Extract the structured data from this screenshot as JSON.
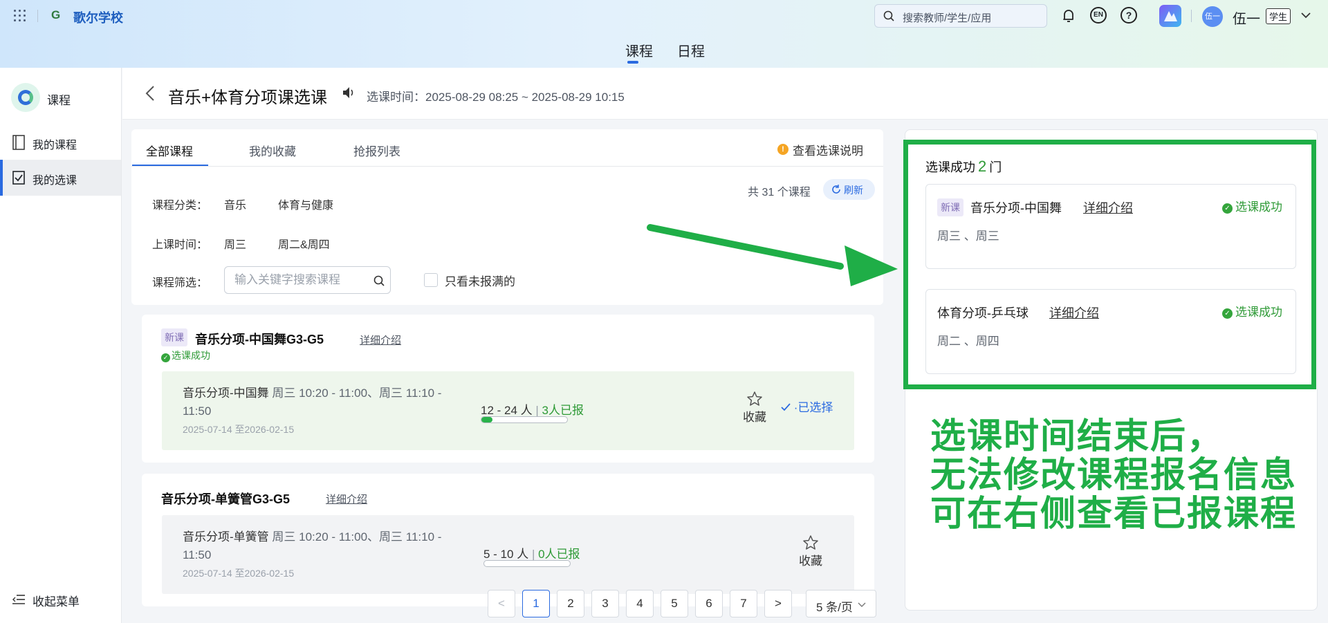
{
  "header": {
    "school_logo_letter": "G",
    "school_name": "歌尔学校",
    "search_placeholder": "搜索教师/学生/应用",
    "lang_badge": "EN",
    "help_mark": "?",
    "avatar_text": "伍一",
    "user_name": "伍一",
    "role_tag": "学生",
    "nav_tabs": [
      {
        "label": "课程"
      },
      {
        "label": "日程"
      }
    ],
    "active_nav": "课程"
  },
  "sidebar": {
    "title": "课程",
    "items": [
      {
        "label": "我的课程"
      },
      {
        "label": "我的选课"
      }
    ],
    "collapse_label": "收起菜单"
  },
  "page": {
    "title": "音乐+体育分项课选课",
    "time_label": "选课时间：2025-08-29 08:25 ~ 2025-08-29 10:15"
  },
  "tabs": [
    {
      "label": "全部课程"
    },
    {
      "label": "我的收藏"
    },
    {
      "label": "抢报列表"
    }
  ],
  "hint": {
    "icon": "!",
    "label": "查看选课说明"
  },
  "filters": {
    "category_label": "课程分类：",
    "categories": [
      "音乐",
      "体育与健康"
    ],
    "time_label": "上课时间：",
    "times": [
      "周三",
      "周二&周四"
    ],
    "keyword_label": "课程筛选：",
    "keyword_placeholder": "输入关键字搜索课程",
    "only_unfull_label": "只看未报满的",
    "total": "共 31 个课程",
    "refresh_label": "刷新"
  },
  "courses": [
    {
      "tag": "新课",
      "title": "音乐分项-中国舞G3-G5",
      "detail_link": "详细介绍",
      "status": "选课成功",
      "section": {
        "name": "音乐分项-中国舞",
        "schedule": "周三 10:20 - 11:00、周三 11:10 - 11:50",
        "dates": "2025-07-14 至2026-02-15",
        "capacity": "12 - 24 人",
        "sep": "|",
        "enrolled": "3人已报",
        "fill_fraction": 0.125,
        "fav_label": "收藏",
        "chosen_label": "·已选择"
      }
    },
    {
      "tag": "",
      "title": "音乐分项-单簧管G3-G5",
      "detail_link": "详细介绍",
      "status": "",
      "section": {
        "name": "音乐分项-单簧管",
        "schedule": "周三 10:20 - 11:00、周三 11:10 - 11:50",
        "dates": "2025-07-14 至2026-02-15",
        "capacity": "5 - 10 人",
        "sep": "|",
        "enrolled": "0人已报",
        "fill_fraction": 0,
        "fav_label": "收藏",
        "chosen_label": ""
      }
    }
  ],
  "pagination": {
    "prev": "<",
    "pages": [
      "1",
      "2",
      "3",
      "4",
      "5",
      "6",
      "7"
    ],
    "current": "1",
    "next": ">",
    "page_size": "5 条/页"
  },
  "selected_panel": {
    "label": "选课成功",
    "count": "2",
    "unit": "门",
    "courses": [
      {
        "tag": "新课",
        "name": "音乐分项-中国舞",
        "detail_link": "详细介绍",
        "days": "周三 、周三",
        "status": "选课成功"
      },
      {
        "tag": "",
        "name": "体育分项-乒乓球",
        "detail_link": "详细介绍",
        "days": "周二 、周四",
        "status": "选课成功"
      }
    ]
  },
  "annotation": {
    "line1": "选课时间结束后，",
    "line2": "无法修改课程报名信息",
    "line3": "可在右侧查看已报课程",
    "color": "#1fae47"
  },
  "colors": {
    "accent": "#2a6ae0",
    "success": "#2e9a36",
    "annotation_green": "#1fae47"
  }
}
